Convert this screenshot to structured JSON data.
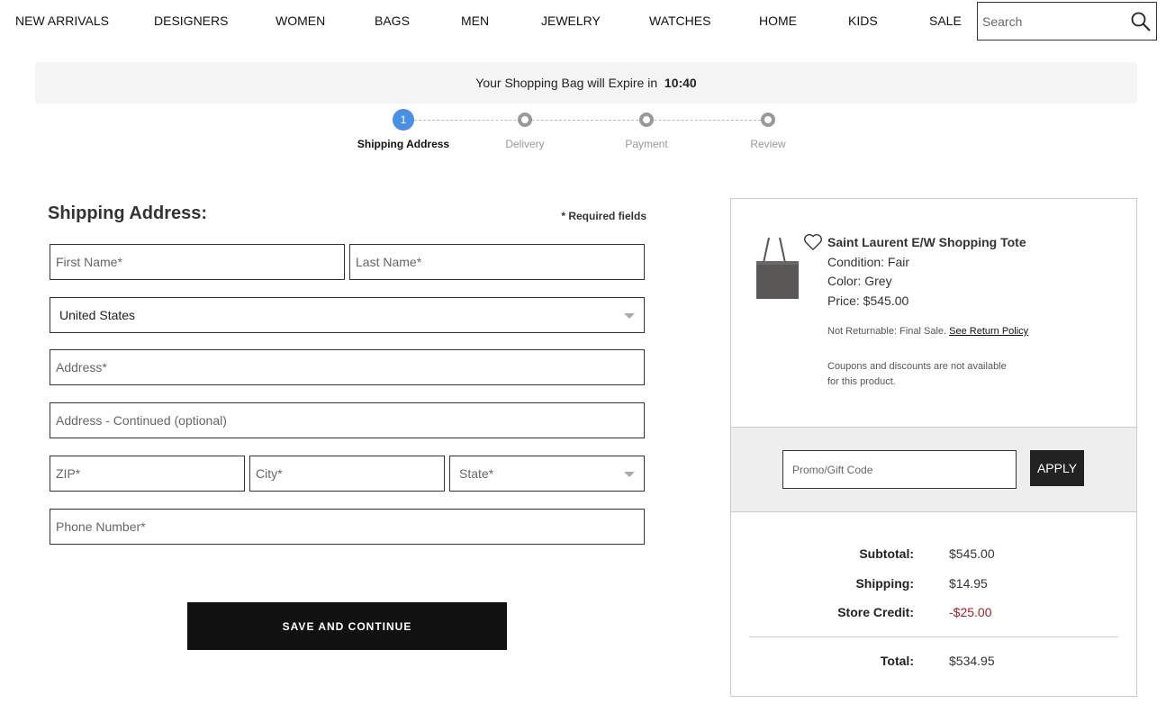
{
  "nav": [
    "NEW ARRIVALS",
    "DESIGNERS",
    "WOMEN",
    "BAGS",
    "MEN",
    "JEWELRY",
    "WATCHES",
    "HOME",
    "KIDS",
    "SALE"
  ],
  "search": {
    "placeholder": "Search",
    "icon": "search-icon"
  },
  "banner": {
    "text": "Your Shopping Bag will Expire in",
    "time": "10:40"
  },
  "steps": [
    {
      "label": "Shipping Address",
      "number": "1",
      "active": true
    },
    {
      "label": "Delivery"
    },
    {
      "label": "Payment"
    },
    {
      "label": "Review"
    }
  ],
  "colors": {
    "accent": "#4a90e2",
    "negative": "#a0202a"
  },
  "form": {
    "title": "Shipping Address:",
    "required": "* Required fields",
    "first_name": "First Name*",
    "last_name": "Last Name*",
    "country": "United States",
    "address": "Address*",
    "address2": "Address - Continued (optional)",
    "zip": "ZIP*",
    "city": "City*",
    "state": "State*",
    "phone": "Phone Number*",
    "submit": "SAVE AND CONTINUE"
  },
  "product": {
    "name": "Saint Laurent E/W Shopping Tote",
    "condition": "Condition: Fair",
    "color": "Color: Grey",
    "price": "Price: $545.00",
    "returns": "Not Returnable: Final Sale.",
    "return_link": "See Return Policy",
    "coupon_note": "Coupons and discounts are not available for this product."
  },
  "promo": {
    "placeholder": "Promo/Gift Code",
    "apply": "APPLY"
  },
  "totals": {
    "subtotal_label": "Subtotal:",
    "subtotal": "$545.00",
    "shipping_label": "Shipping:",
    "shipping": "$14.95",
    "credit_label": "Store Credit:",
    "credit": "-$25.00",
    "total_label": "Total:",
    "total": "$534.95"
  }
}
